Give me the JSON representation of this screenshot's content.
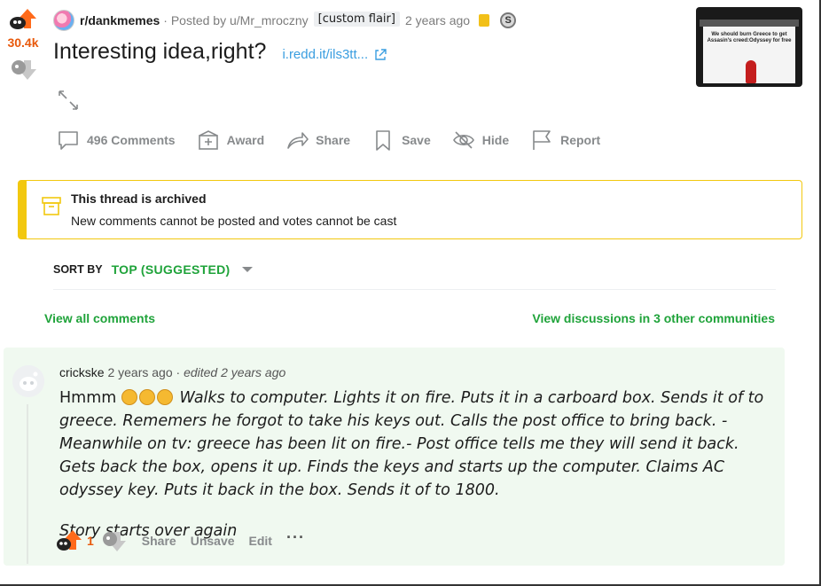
{
  "post": {
    "score": "30.4k",
    "subreddit": "r/dankmemes",
    "posted_by": "· Posted by u/Mr_mroczny",
    "flair": "[custom flair]",
    "age": "2 years ago",
    "title": "Interesting idea,right?",
    "link_text": "i.redd.it/ils3tt...",
    "thumbnail_caption": "We should burn Greece to get Assasin's creed:Odyssey for free"
  },
  "actions": {
    "comments": "496 Comments",
    "award": "Award",
    "share": "Share",
    "save": "Save",
    "hide": "Hide",
    "report": "Report"
  },
  "archive": {
    "title": "This thread is archived",
    "text": "New comments cannot be posted and votes cannot be cast"
  },
  "sort": {
    "label": "SORT BY",
    "value": "TOP (SUGGESTED)"
  },
  "links": {
    "view_all": "View all comments",
    "view_discussions": "View discussions in 3 other communities"
  },
  "comment": {
    "author": "crickske",
    "age": "2 years ago",
    "separator": "·",
    "edited": "edited 2 years ago",
    "body_prefix": "Hmmm",
    "body_main": "Walks to computer. Lights it on fire. Puts it in a carboard box. Sends it of to greece. Rememers he forgot to take his keys out. Calls the post office to bring back. -Meanwhile on tv: greece has been lit on fire.- Post office tells me they will send it back. Gets back the box, opens it up. Finds the keys and starts up the computer. Claims AC odyssey key. Puts it back in the box. Sends it of to 1800.",
    "body_second": "Story starts over again",
    "score": "1",
    "share": "Share",
    "unsave": "Unsave",
    "edit": "Edit",
    "more": "···"
  },
  "colors": {
    "upvote": "#e8590c",
    "green_link": "#1fa33a",
    "archive_border": "#f2c80f",
    "comment_bg": "#f0f9f0"
  }
}
